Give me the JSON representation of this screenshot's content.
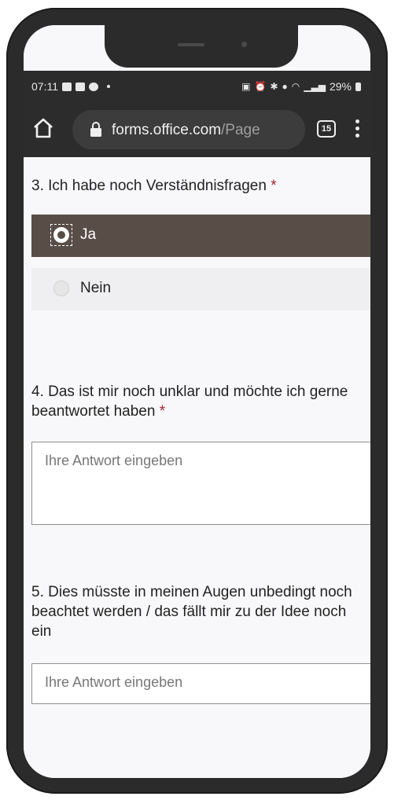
{
  "status_bar": {
    "time": "07:11",
    "battery": "29%"
  },
  "browser": {
    "url_domain": "forms.office.com",
    "url_path": "/Page",
    "tab_count": "15"
  },
  "form": {
    "q3": {
      "number_title": "3. Ich habe noch Verständnisfragen",
      "required_mark": "*",
      "options": [
        {
          "label": "Ja",
          "selected": true
        },
        {
          "label": "Nein",
          "selected": false
        }
      ]
    },
    "q4": {
      "number_title": "4. Das ist mir noch unklar und möchte ich gerne beantwortet haben",
      "required_mark": "*",
      "placeholder": "Ihre Antwort eingeben"
    },
    "q5": {
      "number_title": "5. Dies müsste in meinen Augen unbedingt noch beachtet werden / das fällt mir zu der Idee noch ein",
      "placeholder": "Ihre Antwort eingeben"
    }
  },
  "colors": {
    "selected_option_bg": "#584d47",
    "required": "#a4262c",
    "browser_chrome": "#2c2c2c"
  },
  "icons": [
    "home-icon",
    "lock-icon",
    "tabs-icon",
    "overflow-menu-icon",
    "gallery-icon",
    "linkedin-icon",
    "info-icon",
    "alarm-icon",
    "bluetooth-icon",
    "location-icon",
    "wifi-icon",
    "signal-icon",
    "battery-icon"
  ]
}
